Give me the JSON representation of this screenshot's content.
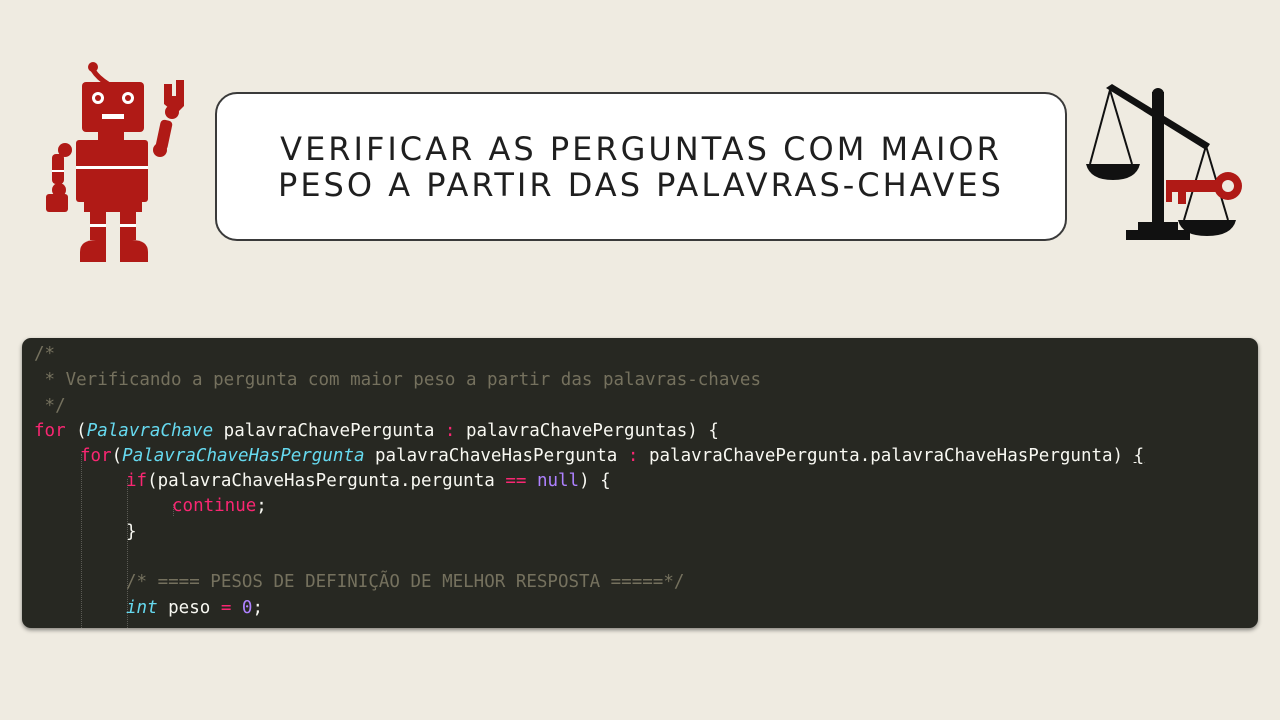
{
  "slide": {
    "title_line1": "VERIFICAR AS PERGUNTAS COM MAIOR",
    "title_line2": "PESO A PARTIR DAS PALAVRAS-CHAVES"
  },
  "icons": {
    "left": "robot-icon",
    "right": "scale-with-key-icon"
  },
  "colors": {
    "background": "#efebe1",
    "accent": "#b01a16",
    "code_bg": "#272822",
    "comment": "#75715e",
    "keyword": "#f92672",
    "type": "#66d9ef",
    "number": "#ae81ff",
    "text": "#f8f8f2"
  },
  "code": {
    "c1": "/*",
    "c2": " * Verificando a pergunta com maior peso a partir das palavras-chaves",
    "c3": " */",
    "l1_kw": "for",
    "l1_a": " (",
    "l1_type": "PalavraChave",
    "l1_b": " palavraChavePergunta ",
    "l1_op": ":",
    "l1_c": " palavraChavePerguntas) {",
    "l2_kw": "for",
    "l2_a": "(",
    "l2_type": "PalavraChaveHasPergunta",
    "l2_b": " palavraChaveHasPergunta ",
    "l2_op": ":",
    "l2_c": " palavraChavePergunta.palavraChaveHasPergunta) ",
    "l2_brace": "{",
    "l3_kw": "if",
    "l3_a": "(palavraChaveHasPergunta.pergunta ",
    "l3_op": "==",
    "l3_sp": " ",
    "l3_null": "null",
    "l3_b": ") {",
    "l4_kw": "continue",
    "l4_a": ";",
    "l5": "}",
    "l6_cmt": "/* ==== PESOS DE DEFINIÇÃO DE MELHOR RESPOSTA =====*/",
    "l7_type": "int",
    "l7_a": " peso ",
    "l7_op": "=",
    "l7_sp": " ",
    "l7_num": "0",
    "l7_b": ";"
  }
}
